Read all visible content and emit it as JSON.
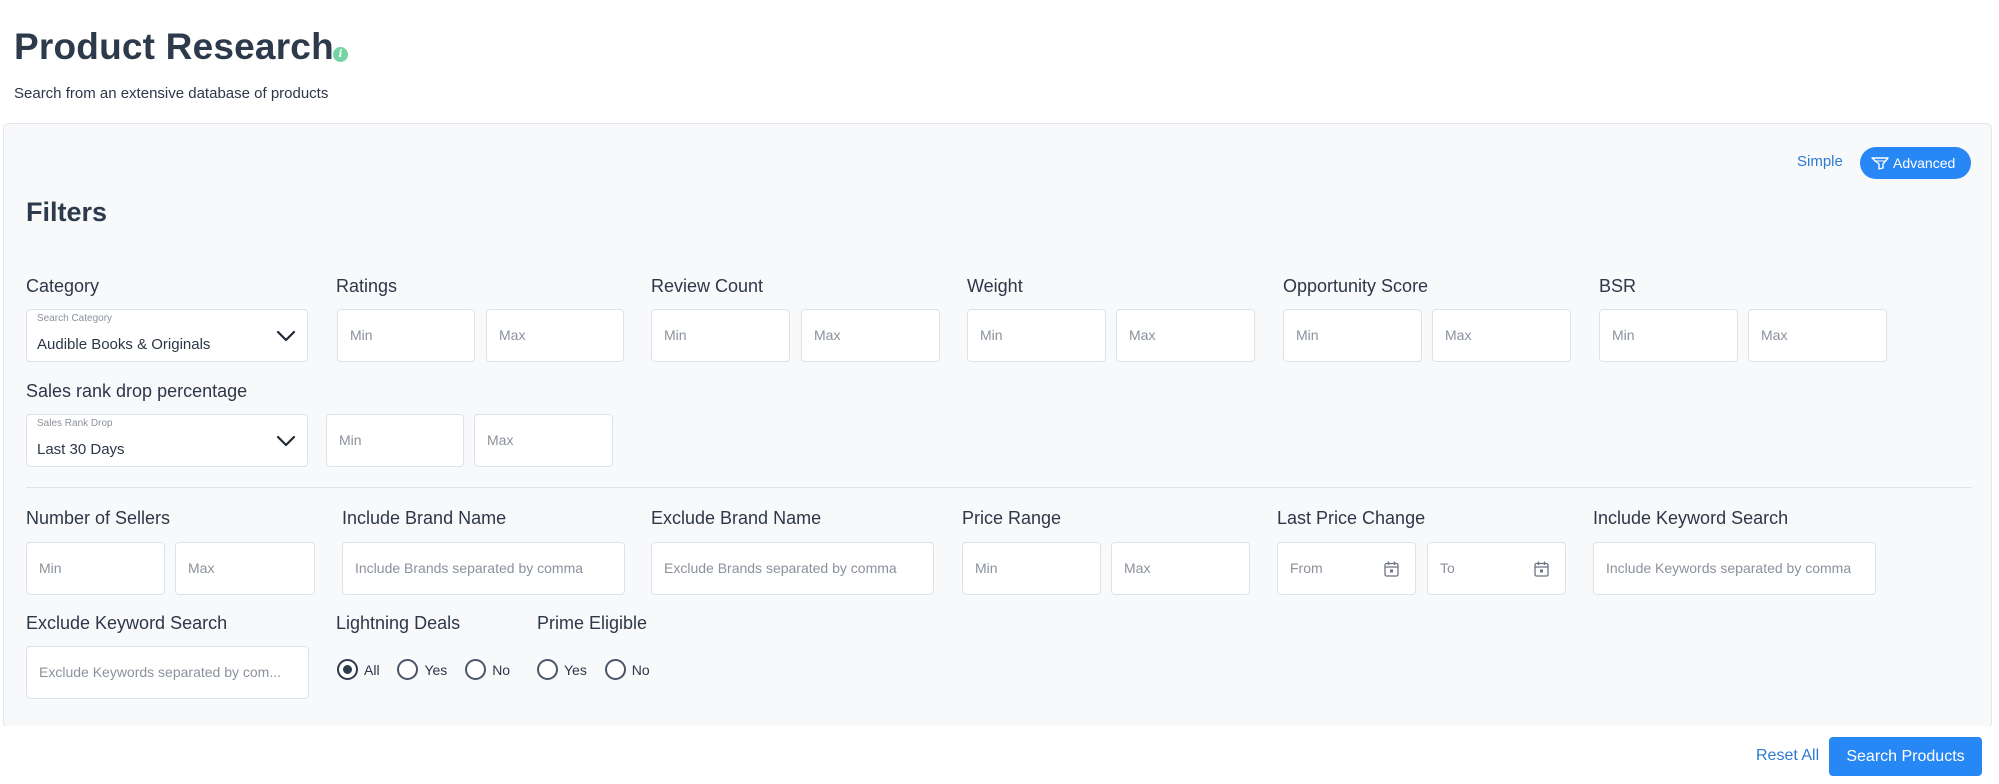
{
  "header": {
    "title": "Product Research",
    "subtitle": "Search from an extensive database of products",
    "info_icon": "info-icon"
  },
  "mode_toggle": {
    "simple_label": "Simple",
    "advanced_label": "Advanced",
    "active": "Advanced",
    "accent_color": "#2787f5"
  },
  "filters": {
    "heading": "Filters",
    "category": {
      "label": "Category",
      "float_label": "Search Category",
      "value": "Audible Books & Originals"
    },
    "ratings": {
      "label": "Ratings",
      "min_placeholder": "Min",
      "max_placeholder": "Max"
    },
    "review_count": {
      "label": "Review Count",
      "min_placeholder": "Min",
      "max_placeholder": "Max"
    },
    "weight": {
      "label": "Weight",
      "min_placeholder": "Min",
      "max_placeholder": "Max"
    },
    "opportunity_score": {
      "label": "Opportunity Score",
      "min_placeholder": "Min",
      "max_placeholder": "Max"
    },
    "bsr": {
      "label": "BSR",
      "min_placeholder": "Min",
      "max_placeholder": "Max"
    },
    "sales_rank_drop": {
      "label": "Sales rank drop percentage",
      "float_label": "Sales Rank Drop",
      "value": "Last 30 Days",
      "min_placeholder": "Min",
      "max_placeholder": "Max"
    },
    "number_of_sellers": {
      "label": "Number of Sellers",
      "min_placeholder": "Min",
      "max_placeholder": "Max"
    },
    "include_brand": {
      "label": "Include Brand Name",
      "placeholder": "Include Brands separated by comma"
    },
    "exclude_brand": {
      "label": "Exclude Brand Name",
      "placeholder": "Exclude Brands separated by comma"
    },
    "price_range": {
      "label": "Price Range",
      "min_placeholder": "Min",
      "max_placeholder": "Max"
    },
    "last_price_change": {
      "label": "Last Price Change",
      "from_placeholder": "From",
      "to_placeholder": "To"
    },
    "include_keyword": {
      "label": "Include Keyword Search",
      "placeholder": "Include Keywords separated by comma"
    },
    "exclude_keyword": {
      "label": "Exclude Keyword Search",
      "placeholder": "Exclude Keywords separated by com..."
    },
    "lightning_deals": {
      "label": "Lightning Deals",
      "options": [
        "All",
        "Yes",
        "No"
      ],
      "selected": "All"
    },
    "prime_eligible": {
      "label": "Prime Eligible",
      "options": [
        "Yes",
        "No"
      ],
      "selected": ""
    }
  },
  "footer": {
    "reset_label": "Reset All",
    "search_label": "Search Products"
  }
}
